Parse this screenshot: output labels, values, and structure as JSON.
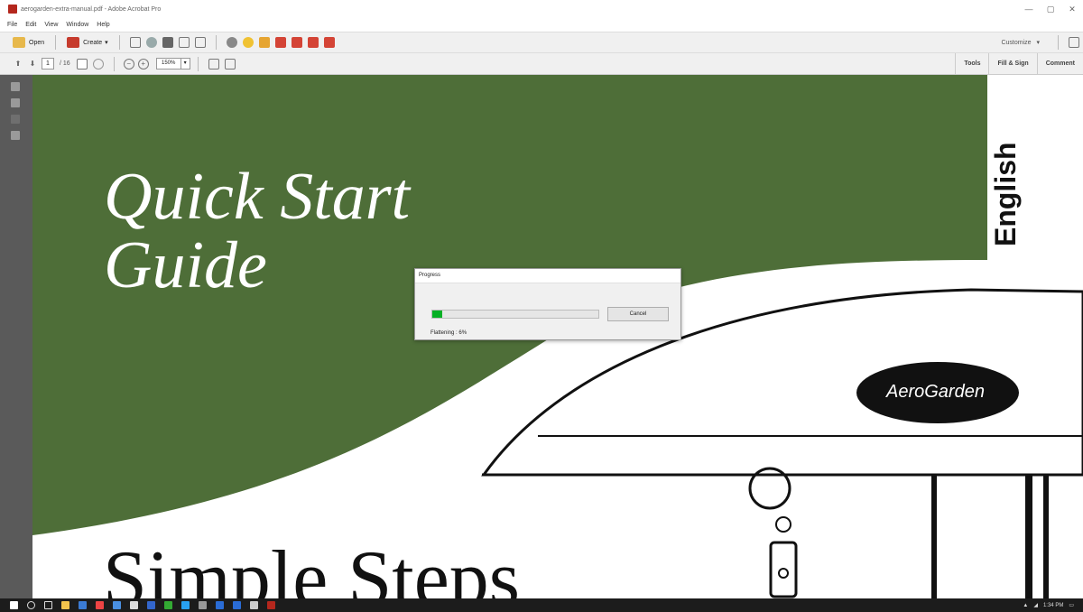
{
  "window": {
    "title": "aerogarden-extra-manual.pdf - Adobe Acrobat Pro",
    "minimize": "—",
    "maximize": "▢",
    "close": "✕"
  },
  "menu": {
    "items": [
      "File",
      "Edit",
      "View",
      "Window",
      "Help"
    ]
  },
  "toolbar": {
    "open_label": "Open",
    "create_label": "Create",
    "create_arrow": "▾",
    "customize_label": "Customize",
    "customize_arrow": "▾"
  },
  "nav": {
    "page_number": "1",
    "page_of": "/ 16",
    "zoom": "150%",
    "zoom_arrow": "▾"
  },
  "right_tabs": {
    "tools": "Tools",
    "fill_sign": "Fill & Sign",
    "comment": "Comment"
  },
  "document": {
    "title_line1": "Quick Start",
    "title_line2": "Guide",
    "language": "English",
    "brand": "AeroGarden",
    "subtitle": "Simple Steps",
    "colors": {
      "green": "#4e6e38"
    }
  },
  "dialog": {
    "title": "Progress",
    "cancel_label": "Cancel",
    "status": "Flattening : 6%",
    "progress": 0.06
  },
  "taskbar": {
    "time": "1:34 PM"
  },
  "icons": [
    "acrobat-icon",
    "folder-icon",
    "create-icon",
    "save-icon",
    "print-icon",
    "email-icon",
    "hand-icon",
    "select-icon",
    "zoom-out-icon",
    "zoom-in-icon",
    "windows-icon",
    "search-icon"
  ]
}
